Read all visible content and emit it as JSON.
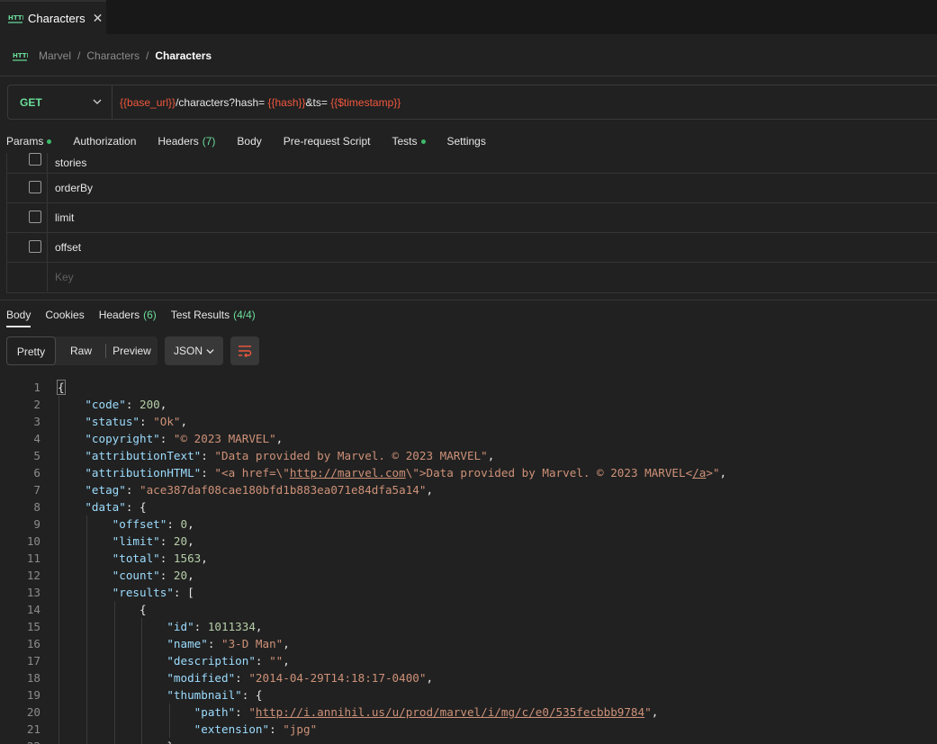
{
  "tab": {
    "title": "Characters",
    "icon": "http-icon",
    "close": "✕"
  },
  "breadcrumb": {
    "items": [
      "Marvel",
      "Characters"
    ],
    "separator": "/",
    "current": "Characters"
  },
  "request": {
    "method": "GET",
    "url_parts": [
      {
        "text": "{{base_url}}",
        "kind": "var"
      },
      {
        "text": "/characters?hash=",
        "kind": "plain"
      },
      {
        "text": " {{hash}}",
        "kind": "var"
      },
      {
        "text": "&ts=",
        "kind": "plain"
      },
      {
        "text": " {{$timestamp}}",
        "kind": "var"
      }
    ]
  },
  "request_tabs": [
    {
      "label": "Params",
      "dot": true,
      "count": ""
    },
    {
      "label": "Authorization",
      "dot": false,
      "count": ""
    },
    {
      "label": "Headers",
      "dot": false,
      "count": "(7)"
    },
    {
      "label": "Body",
      "dot": false,
      "count": ""
    },
    {
      "label": "Pre-request Script",
      "dot": false,
      "count": ""
    },
    {
      "label": "Tests",
      "dot": true,
      "count": ""
    },
    {
      "label": "Settings",
      "dot": false,
      "count": ""
    }
  ],
  "params": {
    "rows": [
      "stories",
      "orderBy",
      "limit",
      "offset"
    ],
    "key_placeholder": "Key"
  },
  "response_tabs": [
    {
      "label": "Body",
      "count": ""
    },
    {
      "label": "Cookies",
      "count": ""
    },
    {
      "label": "Headers",
      "count": "(6)"
    },
    {
      "label": "Test Results",
      "count": "(4/4)"
    }
  ],
  "formats": {
    "pretty": "Pretty",
    "raw": "Raw",
    "preview": "Preview",
    "language": "JSON"
  },
  "code_lines": [
    [
      [
        "p",
        "{"
      ]
    ],
    [
      [
        "p",
        "    "
      ],
      [
        "k",
        "\"code\""
      ],
      [
        "p",
        ": "
      ],
      [
        "n",
        "200"
      ],
      [
        "p",
        ","
      ]
    ],
    [
      [
        "p",
        "    "
      ],
      [
        "k",
        "\"status\""
      ],
      [
        "p",
        ": "
      ],
      [
        "s",
        "\"Ok\""
      ],
      [
        "p",
        ","
      ]
    ],
    [
      [
        "p",
        "    "
      ],
      [
        "k",
        "\"copyright\""
      ],
      [
        "p",
        ": "
      ],
      [
        "s",
        "\"© 2023 MARVEL\""
      ],
      [
        "p",
        ","
      ]
    ],
    [
      [
        "p",
        "    "
      ],
      [
        "k",
        "\"attributionText\""
      ],
      [
        "p",
        ": "
      ],
      [
        "s",
        "\"Data provided by Marvel. © 2023 MARVEL\""
      ],
      [
        "p",
        ","
      ]
    ],
    [
      [
        "p",
        "    "
      ],
      [
        "k",
        "\"attributionHTML\""
      ],
      [
        "p",
        ": "
      ],
      [
        "s",
        "\"<a href=\\\""
      ],
      [
        "su",
        "http://marvel.com"
      ],
      [
        "s",
        "\\\">Data provided by Marvel. © 2023 MARVEL<"
      ],
      [
        "su",
        "/a"
      ],
      [
        "s",
        ">\""
      ],
      [
        "p",
        ","
      ]
    ],
    [
      [
        "p",
        "    "
      ],
      [
        "k",
        "\"etag\""
      ],
      [
        "p",
        ": "
      ],
      [
        "s",
        "\"ace387daf08cae180bfd1b883ea071e84dfa5a14\""
      ],
      [
        "p",
        ","
      ]
    ],
    [
      [
        "p",
        "    "
      ],
      [
        "k",
        "\"data\""
      ],
      [
        "p",
        ": {"
      ]
    ],
    [
      [
        "p",
        "        "
      ],
      [
        "k",
        "\"offset\""
      ],
      [
        "p",
        ": "
      ],
      [
        "n",
        "0"
      ],
      [
        "p",
        ","
      ]
    ],
    [
      [
        "p",
        "        "
      ],
      [
        "k",
        "\"limit\""
      ],
      [
        "p",
        ": "
      ],
      [
        "n",
        "20"
      ],
      [
        "p",
        ","
      ]
    ],
    [
      [
        "p",
        "        "
      ],
      [
        "k",
        "\"total\""
      ],
      [
        "p",
        ": "
      ],
      [
        "n",
        "1563"
      ],
      [
        "p",
        ","
      ]
    ],
    [
      [
        "p",
        "        "
      ],
      [
        "k",
        "\"count\""
      ],
      [
        "p",
        ": "
      ],
      [
        "n",
        "20"
      ],
      [
        "p",
        ","
      ]
    ],
    [
      [
        "p",
        "        "
      ],
      [
        "k",
        "\"results\""
      ],
      [
        "p",
        ": ["
      ]
    ],
    [
      [
        "p",
        "            {"
      ]
    ],
    [
      [
        "p",
        "                "
      ],
      [
        "k",
        "\"id\""
      ],
      [
        "p",
        ": "
      ],
      [
        "n",
        "1011334"
      ],
      [
        "p",
        ","
      ]
    ],
    [
      [
        "p",
        "                "
      ],
      [
        "k",
        "\"name\""
      ],
      [
        "p",
        ": "
      ],
      [
        "s",
        "\"3-D Man\""
      ],
      [
        "p",
        ","
      ]
    ],
    [
      [
        "p",
        "                "
      ],
      [
        "k",
        "\"description\""
      ],
      [
        "p",
        ": "
      ],
      [
        "s",
        "\"\""
      ],
      [
        "p",
        ","
      ]
    ],
    [
      [
        "p",
        "                "
      ],
      [
        "k",
        "\"modified\""
      ],
      [
        "p",
        ": "
      ],
      [
        "s",
        "\"2014-04-29T14:18:17-0400\""
      ],
      [
        "p",
        ","
      ]
    ],
    [
      [
        "p",
        "                "
      ],
      [
        "k",
        "\"thumbnail\""
      ],
      [
        "p",
        ": {"
      ]
    ],
    [
      [
        "p",
        "                    "
      ],
      [
        "k",
        "\"path\""
      ],
      [
        "p",
        ": "
      ],
      [
        "s",
        "\""
      ],
      [
        "su",
        "http://i.annihil.us/u/prod/marvel/i/mg/c/e0/535fecbbb9784"
      ],
      [
        "s",
        "\""
      ],
      [
        "p",
        ","
      ]
    ],
    [
      [
        "p",
        "                    "
      ],
      [
        "k",
        "\"extension\""
      ],
      [
        "p",
        ": "
      ],
      [
        "s",
        "\"jpg\""
      ]
    ],
    [
      [
        "p",
        "                },"
      ]
    ]
  ],
  "colors": {
    "background": "#212121",
    "tabbar": "#181818",
    "variable": "#f2583e",
    "method": "#6bdd9a",
    "status_dot": "#3dbb6b",
    "json_key": "#9cdcfe",
    "json_string": "#ce9178",
    "json_number": "#b5cea8"
  }
}
